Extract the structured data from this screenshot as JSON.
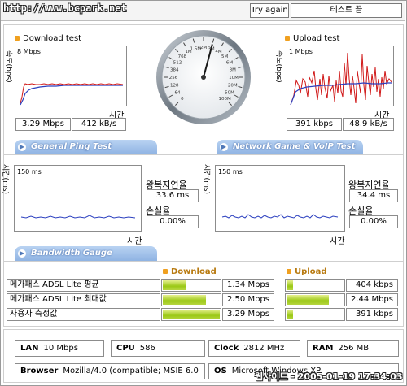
{
  "header": {
    "url_overlay": "http://www.bcpark.net",
    "try_again_label": "Try again",
    "status_text": "테스트 끝"
  },
  "download": {
    "title": "Download test",
    "y_axis_label": "속도(bps)",
    "scale_label": "8 Mbps",
    "x_axis_label": "시간",
    "speed": "3.29 Mbps",
    "rate": "412 kB/s"
  },
  "upload": {
    "title": "Upload test",
    "y_axis_label": "속도(bps)",
    "scale_label": "1 Mbps",
    "x_axis_label": "시간",
    "speed": "391 kbps",
    "rate": "48.9 kB/s"
  },
  "gauge": {
    "ticks": [
      "0",
      "64",
      "128",
      "256",
      "384",
      "512",
      "768",
      "1M",
      "1.5M",
      "2M",
      "3M",
      "4M",
      "5M",
      "6M",
      "8M",
      "10M",
      "20M",
      "50M",
      "100M"
    ],
    "needle_value": "3M"
  },
  "tabs": {
    "ping": "General Ping Test",
    "game": "Network Game & VoIP Test",
    "bandwidth": "Bandwidth Gauge"
  },
  "ping_left": {
    "y_axis_label": "시간(ms)",
    "scale_label": "150 ms",
    "x_axis_label": "시간",
    "rtt_label": "왕복지연율",
    "rtt_value": "33.6 ms",
    "loss_label": "손실율",
    "loss_value": "0.00%"
  },
  "ping_right": {
    "y_axis_label": "시간(ms)",
    "scale_label": "150 ms",
    "x_axis_label": "시간",
    "rtt_label": "왕복지연율",
    "rtt_value": "34.4 ms",
    "loss_label": "손실율",
    "loss_value": "0.00%"
  },
  "bandwidth": {
    "download_header": "Download",
    "upload_header": "Upload",
    "rows": [
      {
        "label": "메가패스 ADSL Lite 평균",
        "down_value": "1.34 Mbps",
        "down_fraction": 0.41,
        "up_value": "404 kbps",
        "up_fraction": 0.12
      },
      {
        "label": "메가패스 ADSL Lite 최대값",
        "down_value": "2.50 Mbps",
        "down_fraction": 0.76,
        "up_value": "2.44 Mbps",
        "up_fraction": 0.74
      },
      {
        "label": "사용자 측정값",
        "down_value": "3.29 Mbps",
        "down_fraction": 1.0,
        "up_value": "391 kbps",
        "up_fraction": 0.12
      }
    ]
  },
  "system": {
    "lan_label": "LAN",
    "lan_value": "10 Mbps",
    "cpu_label": "CPU",
    "cpu_value": "586",
    "clock_label": "Clock",
    "clock_value": "2812 MHz",
    "ram_label": "RAM",
    "ram_value": "256 MB",
    "browser_label": "Browser",
    "browser_value": "Mozilla/4.0 (compatible; MSIE 6.0",
    "os_label": "OS",
    "os_value": "Microsoft Windows XP"
  },
  "watermark": "웹사이트 - 2005-01-19 17:34:03",
  "colors": {
    "accent_tab": "#8fb3e3",
    "download_line": "#2b3fbf",
    "upload_line": "#d01818",
    "bar_fill": "#9bc816",
    "legend_dot": "#f0a020"
  }
}
